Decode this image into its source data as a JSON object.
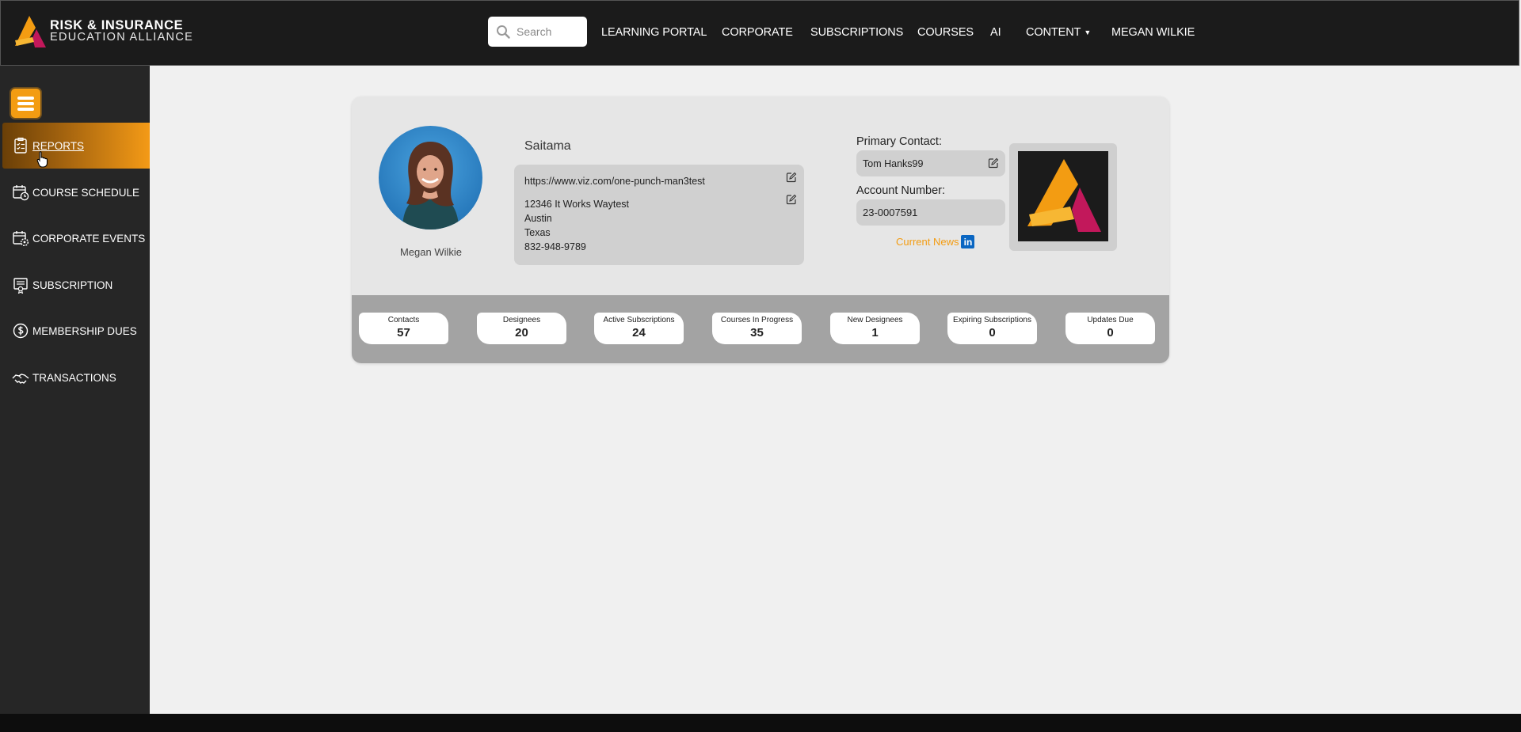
{
  "brand": {
    "line1": "RISK & INSURANCE",
    "line2": "EDUCATION ALLIANCE",
    "colors": {
      "orange": "#f39c12",
      "crimson": "#c2185b"
    }
  },
  "search": {
    "placeholder": "Search",
    "value": ""
  },
  "nav": {
    "items": [
      {
        "label": "LEARNING PORTAL"
      },
      {
        "label": "CORPORATE"
      },
      {
        "label": "SUBSCRIPTIONS"
      },
      {
        "label": "COURSES"
      },
      {
        "label": "AI"
      },
      {
        "label": "CONTENT",
        "has_dropdown": true
      },
      {
        "label": "MEGAN WILKIE"
      }
    ]
  },
  "sidebar": {
    "toggle_icon": "hamburger-icon",
    "items": [
      {
        "label": "REPORTS",
        "icon": "report-checklist-icon",
        "active": true
      },
      {
        "label": "COURSE SCHEDULE",
        "icon": "calendar-clock-icon"
      },
      {
        "label": "CORPORATE EVENTS",
        "icon": "calendar-gear-icon"
      },
      {
        "label": "SUBSCRIPTION",
        "icon": "certificate-icon"
      },
      {
        "label": "MEMBERSHIP DUES",
        "icon": "dollar-coin-icon"
      },
      {
        "label": "TRANSACTIONS",
        "icon": "handshake-icon"
      }
    ]
  },
  "profile": {
    "person_name": "Megan Wilkie",
    "company_name": "Saitama",
    "website": "https://www.viz.com/one-punch-man3test",
    "address": {
      "street": "12346 It Works Waytest",
      "city": "Austin",
      "state": "Texas",
      "phone": "832-948-9789"
    },
    "primary_contact_label": "Primary Contact:",
    "primary_contact": "Tom Hanks99",
    "account_number_label": "Account Number:",
    "account_number": "23-0007591",
    "news_label": "Current News",
    "news_icon": "linkedin-icon"
  },
  "stats": [
    {
      "label": "Contacts",
      "value": "57"
    },
    {
      "label": "Designees",
      "value": "20"
    },
    {
      "label": "Active Subscriptions",
      "value": "24"
    },
    {
      "label": "Courses In Progress",
      "value": "35"
    },
    {
      "label": "New Designees",
      "value": "1"
    },
    {
      "label": "Expiring Subscriptions",
      "value": "0"
    },
    {
      "label": "Updates Due",
      "value": "0"
    }
  ],
  "colors": {
    "accent": "#f39c12",
    "topbar": "#1b1b1b",
    "sidebar": "#262626",
    "linkedin": "#0a66c2"
  }
}
